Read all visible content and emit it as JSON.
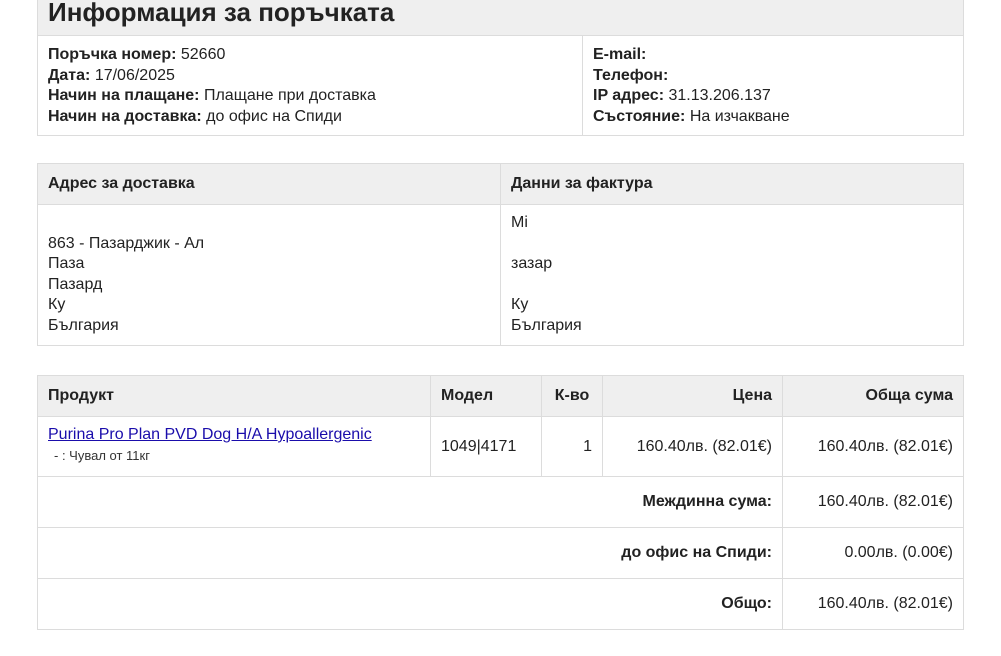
{
  "order_info": {
    "title": "Информация за поръчката",
    "order_number_label": "Поръчка номер:",
    "order_number": "52660",
    "date_label": "Дата:",
    "date": "17/06/2025",
    "payment_label": "Начин на плащане:",
    "payment": "Плащане при доставка",
    "shipping_label": "Начин на доставка:",
    "shipping": "до офис на Спиди",
    "email_label": "E-mail:",
    "phone_label": "Телефон:",
    "ip_label": "IP адрес:",
    "ip": "31.13.206.137",
    "status_label": "Състояние:",
    "status": "На изчакване"
  },
  "addresses": {
    "shipping_header": "Адрес за доставка",
    "billing_header": "Данни за фактура",
    "shipping_lines": [
      "",
      "863 - Пазарджик - Ал",
      "Паза",
      "Пазард",
      "Ку",
      "България"
    ],
    "billing_lines": [
      "Mi",
      "",
      "зазар",
      "",
      "Ку",
      "България"
    ]
  },
  "products": {
    "headers": {
      "product": "Продукт",
      "model": "Модел",
      "qty": "К-во",
      "price": "Цена",
      "total": "Обща сума"
    },
    "items": [
      {
        "name": "Purina Pro Plan PVD Dog H/A Hypoallergenic",
        "option": "- : Чувал от 11кг",
        "model": "1049|4171",
        "qty": "1",
        "price": "160.40лв. (82.01€)",
        "total": "160.40лв. (82.01€)"
      }
    ],
    "totals": [
      {
        "label": "Междинна сума:",
        "value": "160.40лв. (82.01€)"
      },
      {
        "label": "до офис на Спиди:",
        "value": "0.00лв. (0.00€)"
      },
      {
        "label": "Общо:",
        "value": "160.40лв. (82.01€)"
      }
    ]
  }
}
